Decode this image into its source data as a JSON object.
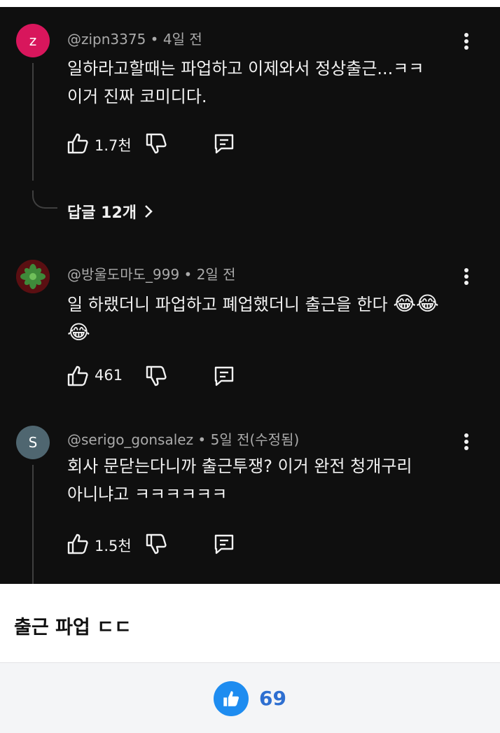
{
  "comments": [
    {
      "avatar_letter": "z",
      "avatar_color": "#d8165c",
      "handle": "@zipn3375",
      "time": "4일 전",
      "text": "일하라고할때는 파업하고 이제와서 정상출근...ㅋㅋ\n이거 진짜 코미디다.",
      "likes": "1.7천",
      "replies_label": "답글 12개"
    },
    {
      "avatar_icon": "plant-avatar",
      "avatar_color": "#5a0f12",
      "handle": "@방울도마도_999",
      "time": "2일 전",
      "text": "일 하랬더니 파업하고 폐업했더니 출근을 한다",
      "emoji_inline": "😂😂",
      "emoji_next": "😂",
      "likes": "461"
    },
    {
      "avatar_letter": "S",
      "avatar_color": "#4f6670",
      "handle": "@serigo_gonsalez",
      "time": "5일 전(수정됨)",
      "text": "회사 문닫는다니까 출근투쟁? 이거 완전 청개구리\n아니냐고 ㅋㅋㅋㅋㅋㅋ",
      "likes": "1.5천"
    }
  ],
  "separator": " • ",
  "post": {
    "caption": "출근 파업 ㄷㄷ",
    "like_count": "69"
  },
  "colors": {
    "background": "#0f0f0f",
    "text": "#f1f1f1",
    "meta": "#aaaaaa",
    "like_blue": "#1e8cf0"
  }
}
